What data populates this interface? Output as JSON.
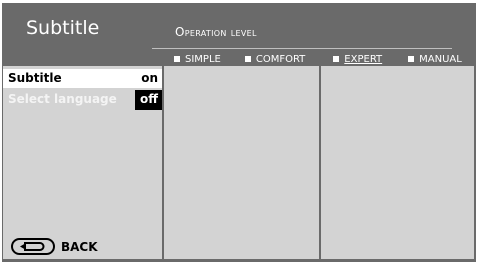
{
  "header": {
    "title": "Subtitle",
    "operation_level_label": "Operation level",
    "levels": [
      {
        "label": "SIMPLE",
        "active": false
      },
      {
        "label": "COMFORT",
        "active": false
      },
      {
        "label": "EXPERT",
        "active": true
      },
      {
        "label": "MANUAL",
        "active": false
      }
    ]
  },
  "menu": {
    "items": [
      {
        "label": "Subtitle",
        "value": "on"
      },
      {
        "label": "Select language",
        "value": "off"
      }
    ]
  },
  "footer": {
    "back_label": "BACK",
    "back_icon": "return-arrow-icon"
  },
  "colors": {
    "header_bg": "#6a6a6a",
    "panel_bg": "#d3d3d3",
    "selected_row_bg": "#ffffff",
    "value_box_bg": "#000000"
  }
}
